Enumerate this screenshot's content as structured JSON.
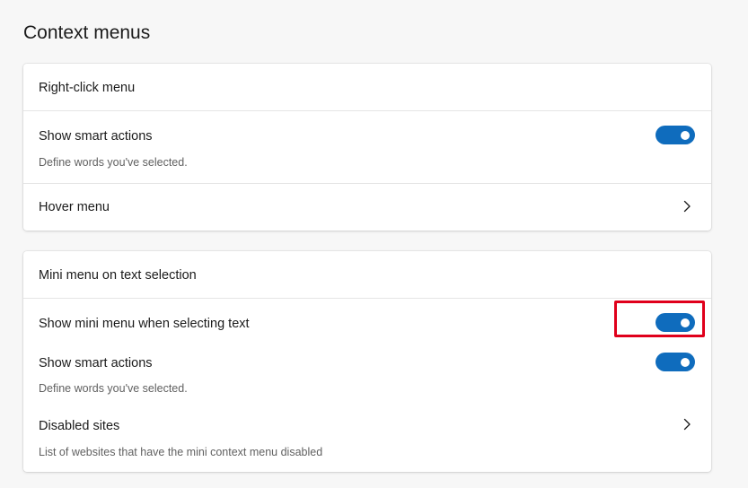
{
  "page": {
    "title": "Context menus"
  },
  "right_click_card": {
    "header": "Right-click menu",
    "smart_actions": {
      "label": "Show smart actions",
      "description": "Define words you've selected.",
      "enabled": true
    },
    "hover_menu": {
      "label": "Hover menu"
    }
  },
  "mini_menu_card": {
    "header": "Mini menu on text selection",
    "show_mini_menu": {
      "label": "Show mini menu when selecting text",
      "enabled": true
    },
    "smart_actions": {
      "label": "Show smart actions",
      "description": "Define words you've selected.",
      "enabled": true
    },
    "disabled_sites": {
      "label": "Disabled sites",
      "description": "List of websites that have the mini context menu disabled"
    }
  },
  "colors": {
    "toggle_on": "#0f6cbd",
    "highlight": "#e0001b"
  },
  "icons": {
    "chevron": "chevron-right-icon"
  }
}
